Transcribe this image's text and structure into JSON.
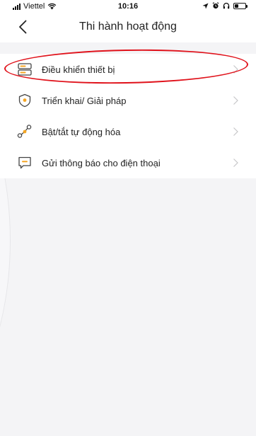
{
  "status_bar": {
    "carrier": "Viettel",
    "time": "10:16",
    "battery_level": 0.35,
    "icons": [
      "signal-icon",
      "wifi-icon",
      "location-icon",
      "alarm-icon",
      "headphones-icon",
      "battery-icon"
    ]
  },
  "header": {
    "title": "Thi hành hoạt động",
    "back_icon": "chevron-left-icon"
  },
  "actions": [
    {
      "label": "Điều khiển thiết bị",
      "icon": "device-control-icon",
      "highlighted": true
    },
    {
      "label": "Triển khai/ Giải pháp",
      "icon": "shield-icon",
      "highlighted": false
    },
    {
      "label": "Bật/tắt tự động hóa",
      "icon": "automation-icon",
      "highlighted": false
    },
    {
      "label": "Gửi thông báo cho điện thoại",
      "icon": "message-icon",
      "highlighted": false
    }
  ],
  "colors": {
    "accent": "#f5a623",
    "highlight_annotation": "#e0121b",
    "background": "#f4f4f6",
    "row_background": "#ffffff"
  }
}
